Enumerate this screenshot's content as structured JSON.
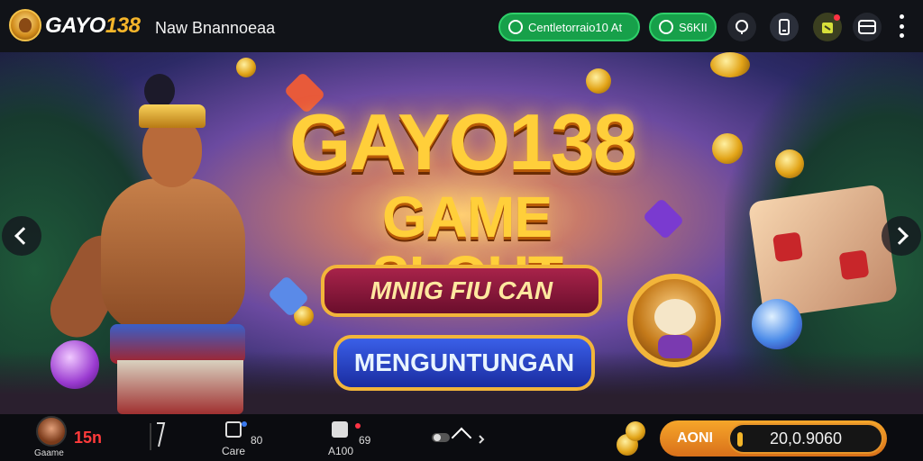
{
  "header": {
    "logo_text_main": "GAYO",
    "logo_text_accent": "138",
    "nav_title": "Naw Bnannoeaa",
    "login_label": "Centletorraio10 At",
    "register_label": "S6KII",
    "icons": [
      "chat-icon",
      "phone-icon",
      "gift-icon",
      "wallet-icon",
      "more-icon"
    ]
  },
  "banner": {
    "headline_1": "GAYO138",
    "headline_2": "GAME SLOUT",
    "badge_text": "MNIIG FIU CAN",
    "cta_text": "MENGUNTUNGAN"
  },
  "bottombar": {
    "user_number": "15n",
    "user_name": "Gaame",
    "item_1_label": "Care",
    "item_1_value": "80",
    "item_2_label": "A100",
    "item_2_value": "69",
    "balance_label": "AONI",
    "balance_value": "20,0.9060"
  },
  "colors": {
    "accent_gold": "#f5b52a",
    "green": "#17a04a",
    "maroon": "#a8234a",
    "blue": "#3a5fe8",
    "orange": "#f6a62a"
  }
}
